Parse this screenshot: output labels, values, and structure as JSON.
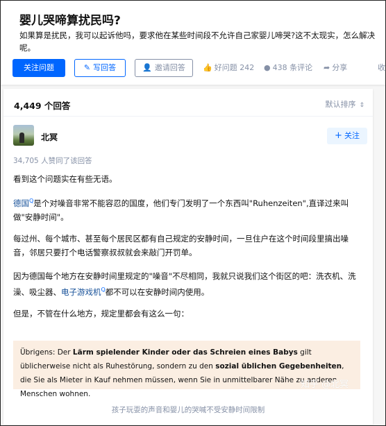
{
  "question": {
    "title": "婴儿哭啼算扰民吗?",
    "description": "如果算是扰民，我可以起诉他吗，要求他在某些时间段不允许自己家婴儿啼哭?这不太现实，怎么解决呢。"
  },
  "actions": {
    "follow_question": "关注问题",
    "write_answer": "写回答",
    "invite_answer": "邀请回答",
    "good_question": "好问题 242",
    "comments": "438 条评论",
    "share": "分享",
    "favorite": "收"
  },
  "answers_header": {
    "count": "4,449 个回答",
    "sort": "默认排序"
  },
  "answer": {
    "author": "北冥",
    "follow": "关注",
    "voters": "34,705 人赞同了该回答",
    "p1": "看到这个问题实在有些无语。",
    "p2_link": "德国",
    "p2_text": "是个对噪音非常不能容忍的国度，他们专门发明了一个东西叫\"Ruhenzeiten\",直译过来叫做\"安静时间\"。",
    "p3": "每过州、每个城市、甚至每个居民区都有自己规定的安静时间，一旦住户在这个时间段里搞出噪音，邻居只要打个电话警察叔叔就会来敲门开罚单。",
    "p4_pre": "因为德国每个地方在安静时间里规定的\"噪音\"不尽相同，我就只说我们这个街区的吧：洗衣机、洗澡、吸尘器、",
    "p4_link": "电子游戏机",
    "p4_post": "都不可以在安静时间内使用。",
    "p5": "但是，不管在什么地方，规定里都会有这么一句：",
    "quote": {
      "t1": "Übrigens: Der ",
      "b1": "Lärm spielender Kinder oder das Schreien eines Babys",
      "t2": " gilt üblicherweise nicht als Ruhestörung, sondern zu den ",
      "b2": "sozial üblichen Gegebenheiten",
      "t3": ", die Sie als Mieter in Kauf nehmen müssen, wenn Sie in unmittelbarer Nähe zu anderen Menschen wohnen."
    },
    "watermark": "知乎 @北冥",
    "caption": "孩子玩耍的声音和婴儿的哭喊不受安静时间限制"
  },
  "colors": {
    "brand_blue": "#0066ff",
    "link_blue": "#175199",
    "muted_gray": "#8590a6",
    "quote_bg": "#fbeee2"
  },
  "icons": [
    "pencil-icon",
    "invite-icon",
    "thumbs-up-icon",
    "comment-icon",
    "share-icon",
    "chevron-updown-icon",
    "plus-icon",
    "link-icon"
  ]
}
